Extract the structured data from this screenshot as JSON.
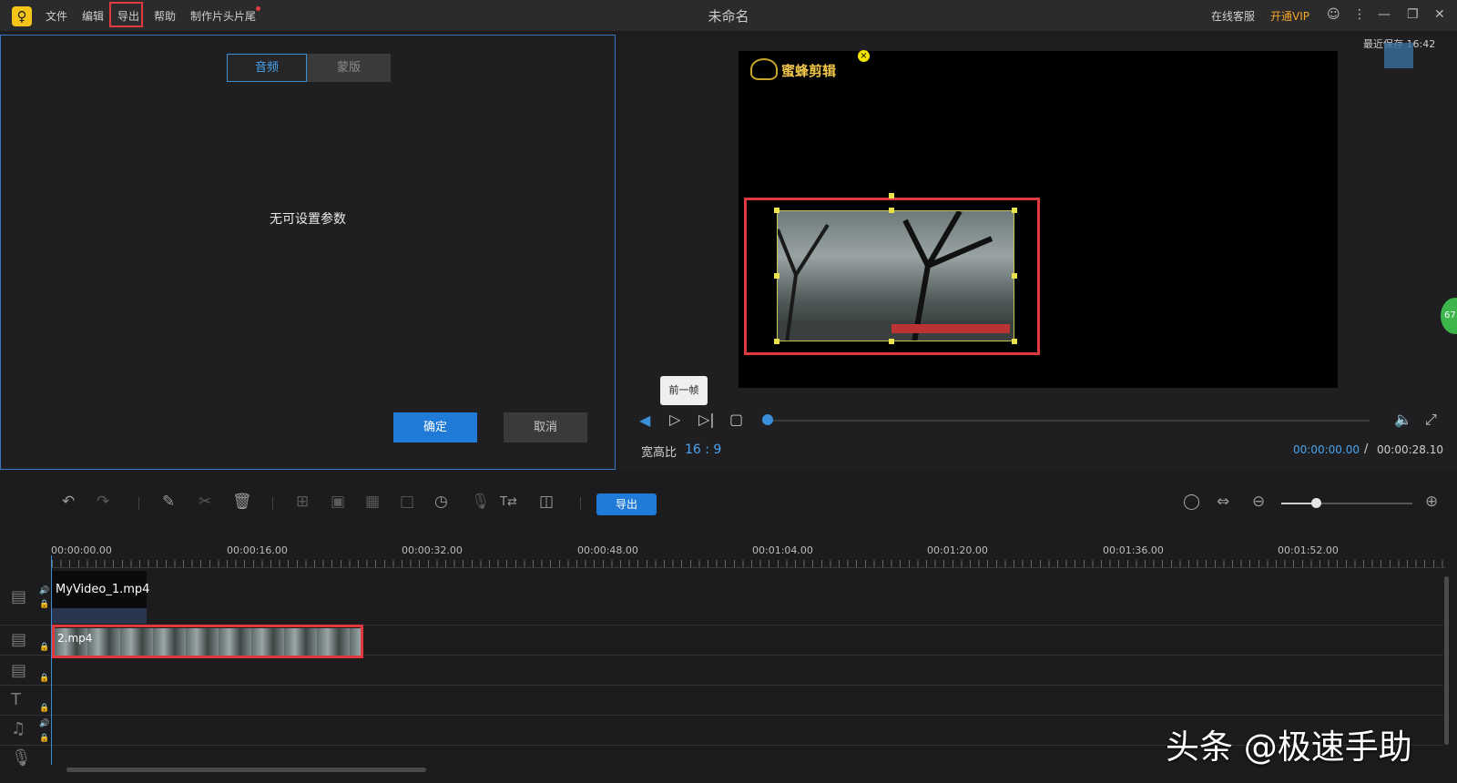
{
  "app": {
    "logo_glyph": "♀",
    "title": "未命名"
  },
  "menu": {
    "file": "文件",
    "edit": "编辑",
    "export": "导出",
    "help": "帮助",
    "intro_outro": "制作片头片尾"
  },
  "header_right": {
    "service": "在线客服",
    "vip": "开通VIP"
  },
  "left_panel": {
    "tab_audio": "音频",
    "tab_mask": "蒙版",
    "message": "无可设置参数",
    "ok": "确定",
    "cancel": "取消"
  },
  "preview": {
    "recent_save": "最近保存 16:42",
    "watermark": "蜜蜂剪辑",
    "badge": "67",
    "tooltip": "前一帧"
  },
  "player": {
    "aspect_label": "宽高比",
    "aspect_value": "16 : 9",
    "time_current": "00:00:00.00",
    "time_sep": "/",
    "time_total": "00:00:28.10",
    "progress": 0
  },
  "toolbar": {
    "export": "导出",
    "zoom_level": 0.23
  },
  "ruler": {
    "labels": [
      "00:00:00.00",
      "00:00:16.00",
      "00:00:32.00",
      "00:00:48.00",
      "00:01:04.00",
      "00:01:20.00",
      "00:01:36.00",
      "00:01:52.00"
    ]
  },
  "tracks": {
    "clip1": "MyVideo_1.mp4",
    "clip2": "2.mp4"
  },
  "overlay": {
    "watermark": "头条 @极速手助"
  },
  "colors": {
    "accent": "#1f7ad8",
    "highlight": "#e0393e",
    "vip": "#f5a623"
  }
}
